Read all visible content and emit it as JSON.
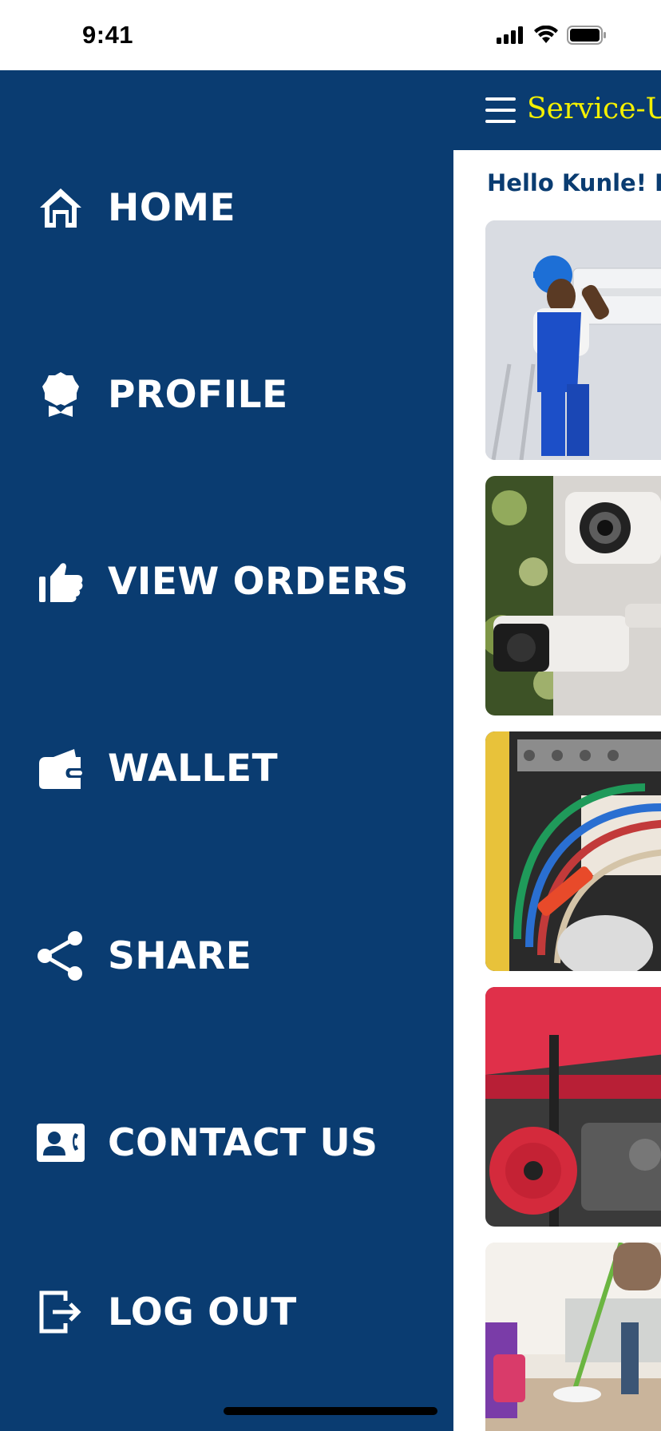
{
  "status_bar": {
    "time": "9:41"
  },
  "header": {
    "brand": "Service-U",
    "greeting": "Hello Kunle! H"
  },
  "drawer": {
    "items": [
      {
        "label": "HOME",
        "icon": "home-icon"
      },
      {
        "label": "PROFILE",
        "icon": "profile-badge-icon"
      },
      {
        "label": "VIEW ORDERS",
        "icon": "thumbs-up-icon"
      },
      {
        "label": "WALLET",
        "icon": "wallet-icon"
      },
      {
        "label": "SHARE",
        "icon": "share-icon"
      },
      {
        "label": "CONTACT US",
        "icon": "contact-card-icon"
      },
      {
        "label": "LOG OUT",
        "icon": "logout-icon"
      }
    ]
  },
  "services": [
    {
      "name": "ac-repair-card"
    },
    {
      "name": "cctv-card"
    },
    {
      "name": "electrical-card"
    },
    {
      "name": "generator-card"
    },
    {
      "name": "cleaning-card"
    }
  ],
  "colors": {
    "primary": "#0a3c71",
    "brand_text": "#f4f000",
    "text_light": "#ffffff"
  }
}
